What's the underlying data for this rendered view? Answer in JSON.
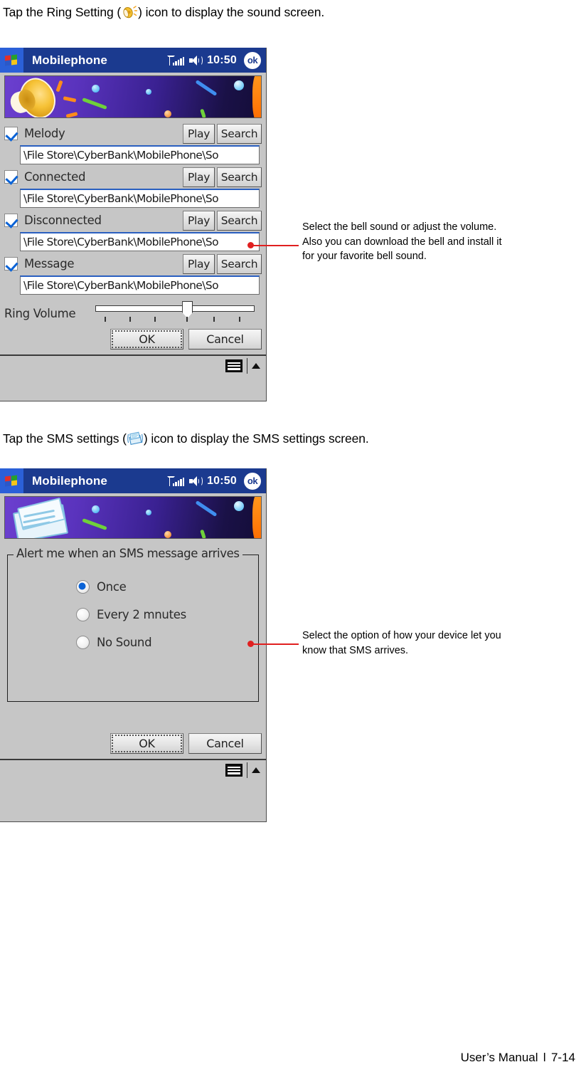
{
  "page": {
    "instruction_1": "Tap the Ring Setting (",
    "instruction_1_end": ") icon to display the sound screen.",
    "instruction_2": "Tap the SMS settings (",
    "instruction_2_end": ") icon to display the SMS settings screen.",
    "ring_icon_name": "bell-icon",
    "sms_icon_name": "envelope-icon"
  },
  "screen1": {
    "titlebar": {
      "start_icon": "windows-flag-icon",
      "title": "Mobilephone",
      "signal_icon": "signal-strength-icon",
      "speaker_icon": "speaker-volume-icon",
      "clock": "10:50",
      "ok_label": "ok"
    },
    "banner_icon": "megaphone-banner",
    "rows": [
      {
        "checked": true,
        "label": "Melody",
        "play": "Play",
        "search": "Search",
        "path": "\\File Store\\CyberBank\\MobilePhone\\So"
      },
      {
        "checked": true,
        "label": "Connected",
        "play": "Play",
        "search": "Search",
        "path": "\\File Store\\CyberBank\\MobilePhone\\So"
      },
      {
        "checked": true,
        "label": "Disconnected",
        "play": "Play",
        "search": "Search",
        "path": "\\File Store\\CyberBank\\MobilePhone\\So"
      },
      {
        "checked": true,
        "label": "Message",
        "play": "Play",
        "search": "Search",
        "path": "\\File Store\\CyberBank\\MobilePhone\\So"
      }
    ],
    "slider": {
      "label": "Ring Volume",
      "ticks": 6,
      "value": 4,
      "max": 6
    },
    "buttons": {
      "ok": "OK",
      "cancel": "Cancel"
    },
    "taskbar": {
      "keyboard_icon": "keyboard-icon",
      "caret_icon": "caret-up-icon"
    }
  },
  "screen2": {
    "titlebar": {
      "start_icon": "windows-flag-icon",
      "title": "Mobilephone",
      "signal_icon": "signal-strength-icon",
      "speaker_icon": "speaker-volume-icon",
      "clock": "10:50",
      "ok_label": "ok"
    },
    "banner_icon": "envelope-banner",
    "groupbox_title": "Alert me when an SMS message arrives",
    "options": [
      {
        "label": "Once",
        "selected": true
      },
      {
        "label": "Every 2 mnutes",
        "selected": false
      },
      {
        "label": "No Sound",
        "selected": false
      }
    ],
    "buttons": {
      "ok": "OK",
      "cancel": "Cancel"
    },
    "taskbar": {
      "keyboard_icon": "keyboard-icon",
      "caret_icon": "caret-up-icon"
    }
  },
  "annotations": {
    "note1": "Select the bell sound or adjust the volume. Also you can download the bell and install it for your favorite bell sound.",
    "note2": "Select the option of how your device let you know that SMS arrives."
  },
  "footer": {
    "manual": "User’s Manual",
    "separator": "ǀ",
    "page_number": "7-14"
  },
  "colors": {
    "titlebar_blue": "#1b3a8f",
    "start_blue": "#2b60d8",
    "chrome_gray": "#c6c6c6",
    "accent_red": "#e02020",
    "check_blue": "#0b63d6"
  }
}
